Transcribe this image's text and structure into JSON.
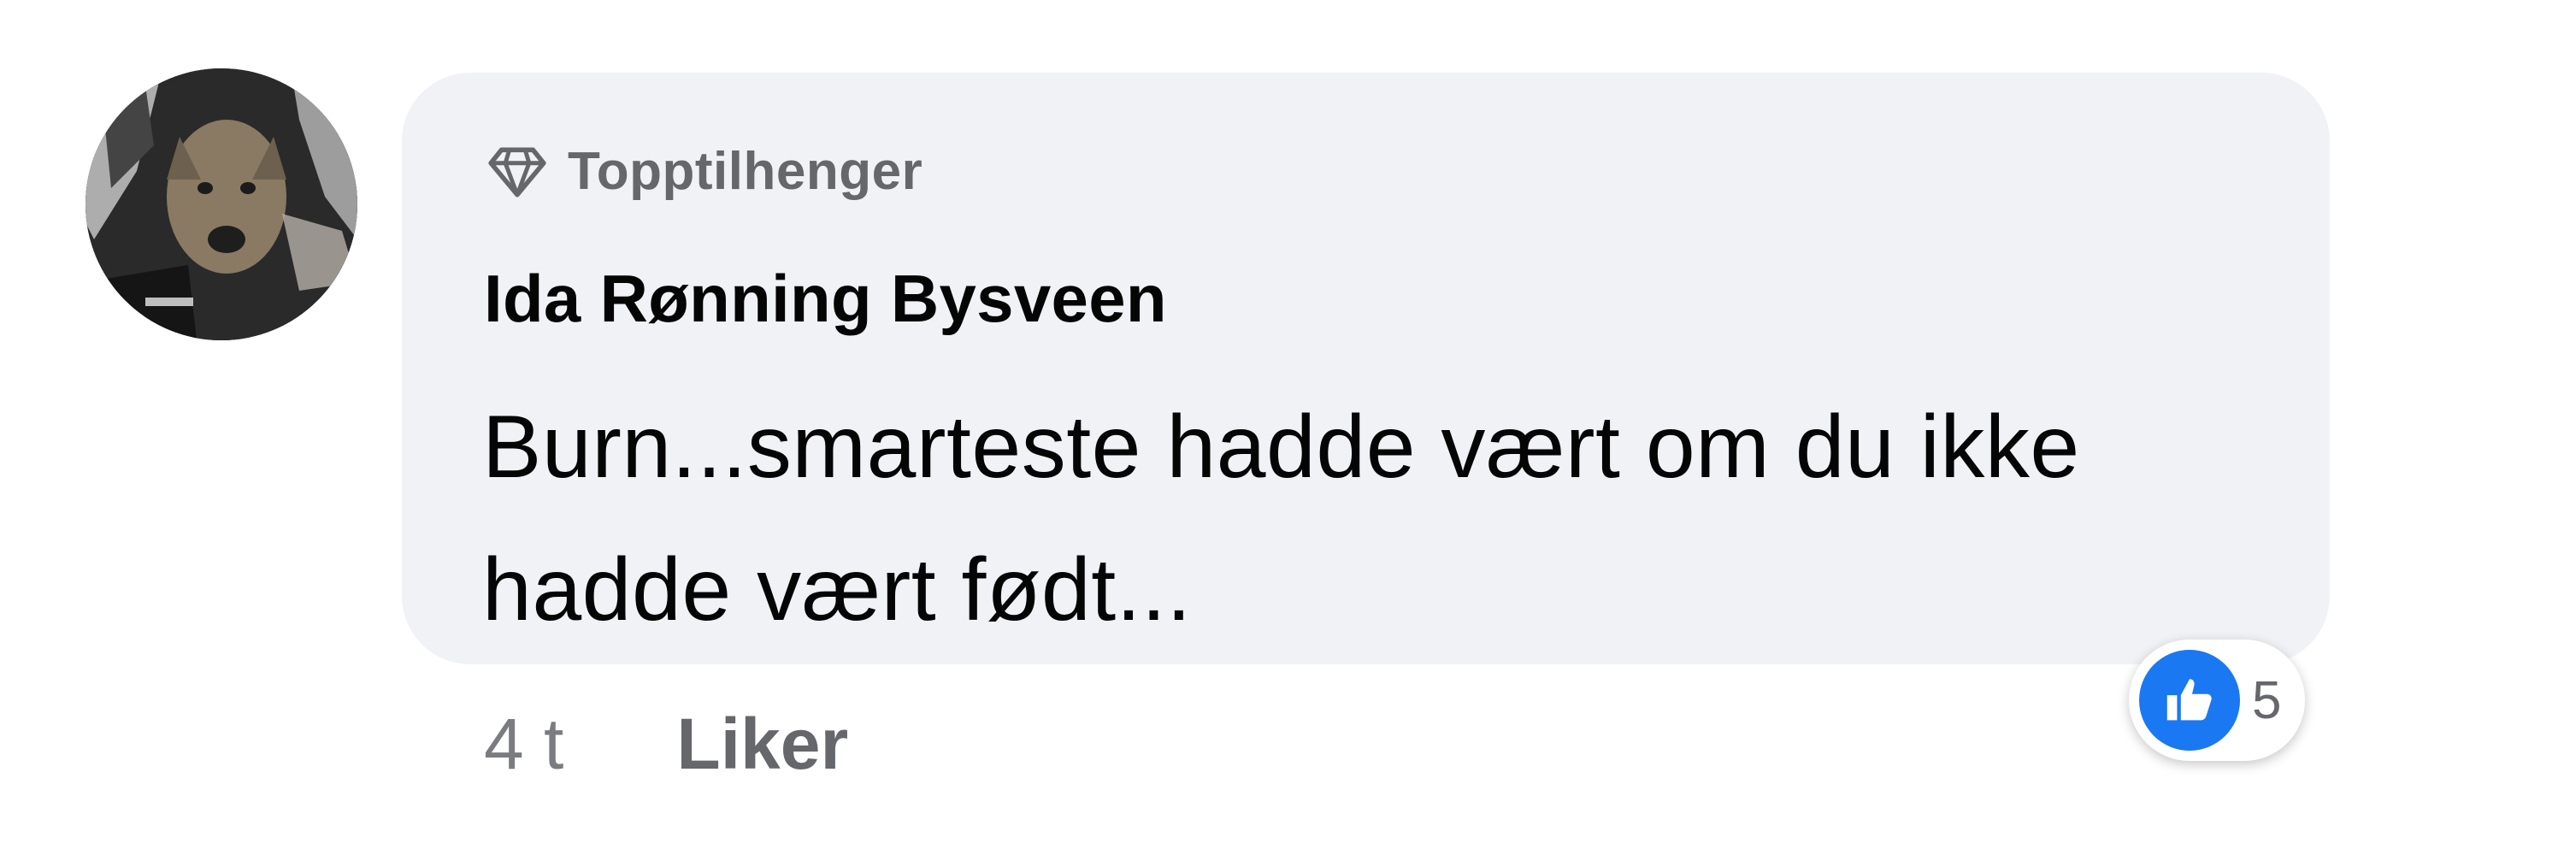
{
  "comment": {
    "badge_icon": "diamond-icon",
    "badge_label": "Topptilhenger",
    "author": "Ida Rønning Bysveen",
    "text": "Burn...smarteste hadde vært om du ikke hadde vært født...",
    "time": "4 t",
    "like_action": "Liker",
    "reactions": {
      "icon": "like-icon",
      "count": "5"
    }
  },
  "colors": {
    "bubble_bg": "#f0f2f5",
    "text": "#050505",
    "secondary_text": "#65676b",
    "like_blue": "#1a78f2"
  }
}
